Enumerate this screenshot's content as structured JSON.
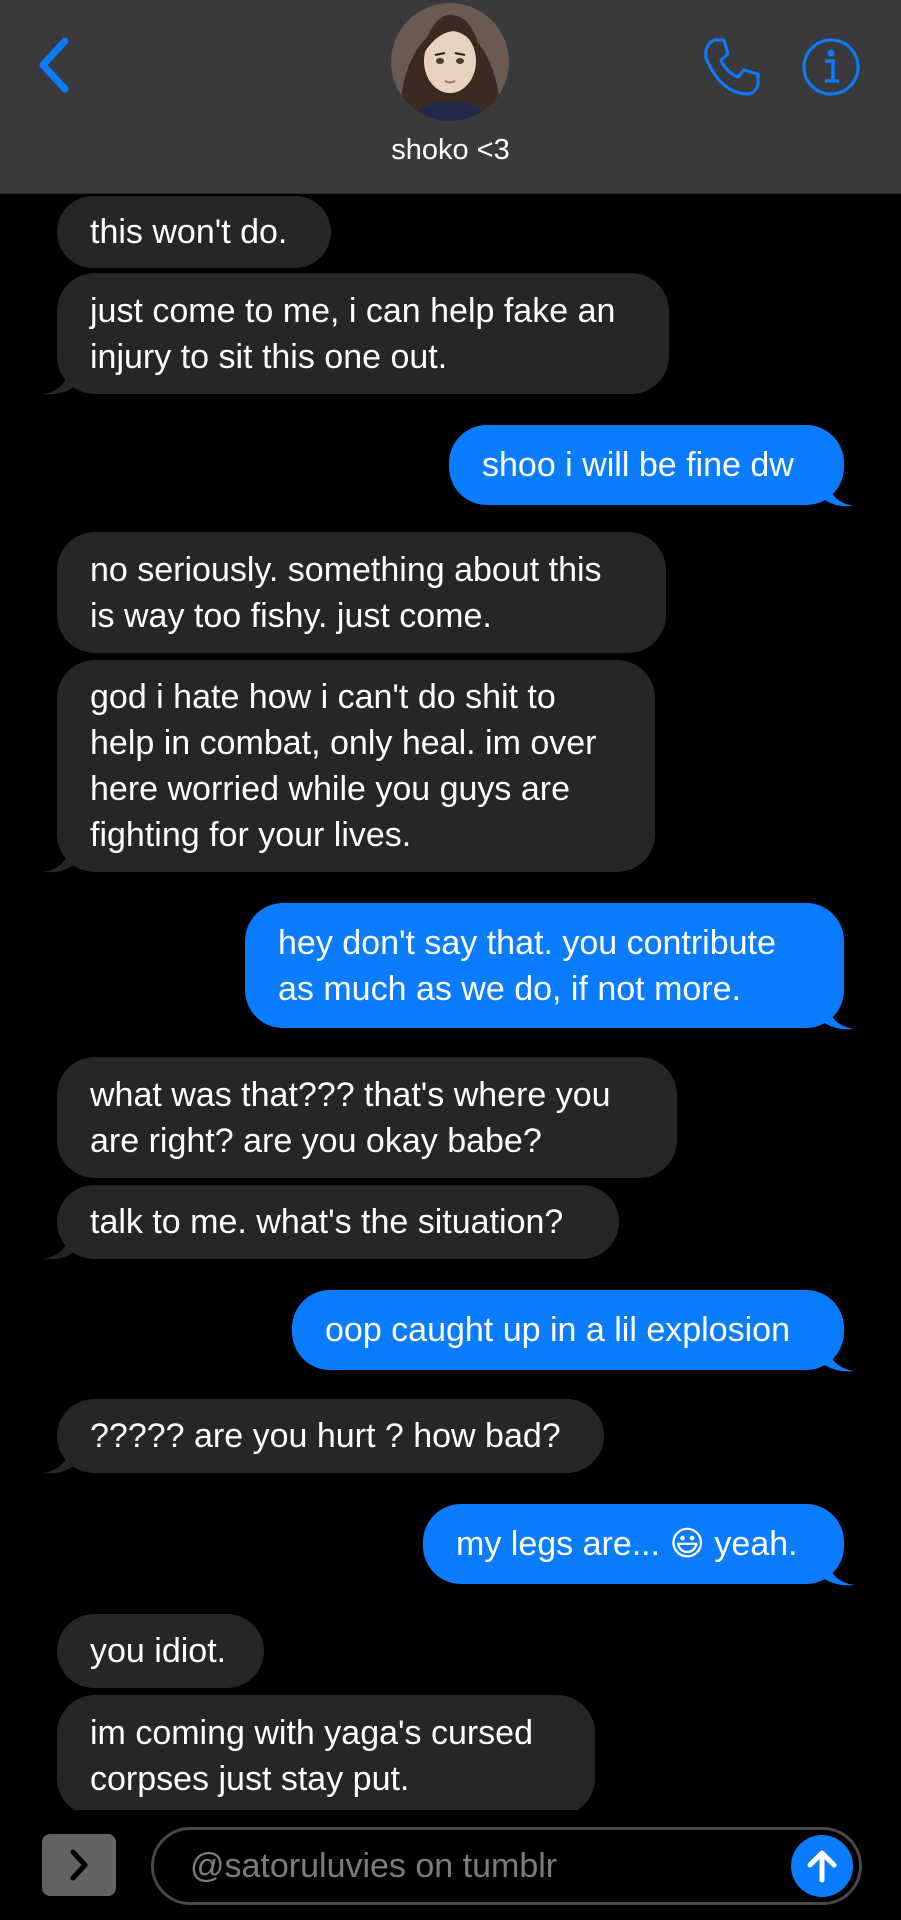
{
  "header": {
    "contact_name": "shoko <3",
    "back_icon": "chevron-left-icon",
    "phone_icon": "phone-icon",
    "info_icon": "info-icon",
    "accent_color": "#0a7cff"
  },
  "messages": [
    {
      "direction": "incoming",
      "text": "this won't do."
    },
    {
      "direction": "incoming",
      "text": "just come to me, i can help fake an\ninjury to sit this one out."
    },
    {
      "direction": "outgoing",
      "text": "shoo i will be fine dw"
    },
    {
      "direction": "incoming",
      "text": "no seriously. something about this\nis way too fishy. just come."
    },
    {
      "direction": "incoming",
      "text": "god i hate how i can't do shit to\nhelp in combat, only heal. im over\nhere worried while you guys are\nfighting for your lives."
    },
    {
      "direction": "outgoing",
      "text": "hey don't say that. you contribute\nas much as we do, if not more."
    },
    {
      "direction": "incoming",
      "text": "what was that??? that's where you\nare right? are you okay babe?"
    },
    {
      "direction": "incoming",
      "text": "talk to me. what's the situation?"
    },
    {
      "direction": "outgoing",
      "text": "oop caught up in a lil explosion"
    },
    {
      "direction": "incoming",
      "text": "????? are you hurt ? how bad?"
    },
    {
      "direction": "outgoing",
      "text": "my legs are... 😃 yeah."
    },
    {
      "direction": "incoming",
      "text": "you idiot."
    },
    {
      "direction": "incoming",
      "text": "im coming with yaga's cursed\ncorpses just stay put."
    }
  ],
  "composer": {
    "placeholder": "@satoruluvies on tumblr",
    "apps_icon": "chevron-right-icon",
    "send_icon": "arrow-up-icon"
  }
}
